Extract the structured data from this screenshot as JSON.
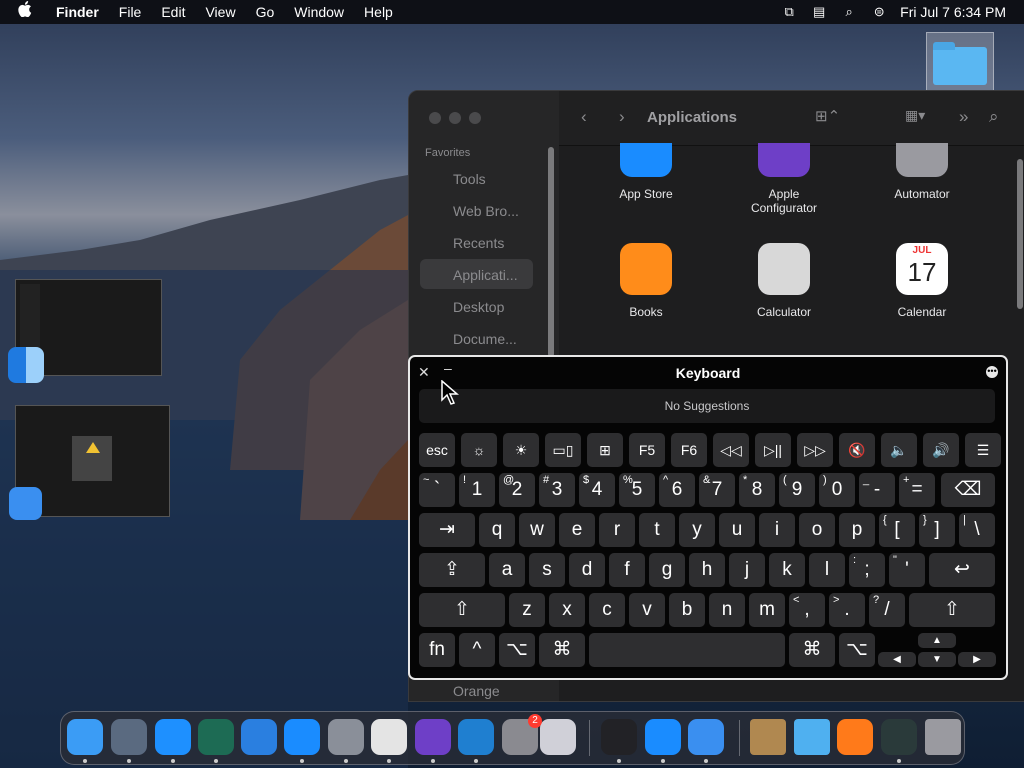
{
  "menubar": {
    "apple_icon": "apple-logo",
    "app_name": "Finder",
    "menus": [
      "File",
      "Edit",
      "View",
      "Go",
      "Window",
      "Help"
    ],
    "clock": "Fri Jul 7  6:34 PM"
  },
  "finder": {
    "sidebar_heading": "Favorites",
    "sidebar_items": [
      "Tools",
      "Web Bro...",
      "Recents",
      "Applicati...",
      "Desktop",
      "Docume...",
      "Orange"
    ],
    "title": "Applications",
    "apps": [
      {
        "label": "App Store",
        "color": "#1a8cff"
      },
      {
        "label": "Apple\nConfigurator",
        "color": "#6e3fc7"
      },
      {
        "label": "Automator",
        "color": "#9a9aa0"
      },
      {
        "label": "Books",
        "color": "#ff8c1a"
      },
      {
        "label": "Calculator",
        "color": "#d8d8d8"
      },
      {
        "label": "Calendar",
        "color": "#ffffff"
      }
    ],
    "calendar_month": "JUL",
    "calendar_day": "17"
  },
  "keyboard": {
    "title": "Keyboard",
    "suggestions": "No Suggestions",
    "fn_row": [
      "esc",
      "☼",
      "☀",
      "▭▯",
      "⊞",
      "F5",
      "F6",
      "◁◁",
      "▷||",
      "▷▷",
      "🔇",
      "🔈",
      "🔊",
      "☰"
    ],
    "number_row": [
      {
        "s": "~",
        "m": "`"
      },
      {
        "s": "!",
        "m": "1"
      },
      {
        "s": "@",
        "m": "2"
      },
      {
        "s": "#",
        "m": "3"
      },
      {
        "s": "$",
        "m": "4"
      },
      {
        "s": "%",
        "m": "5"
      },
      {
        "s": "^",
        "m": "6"
      },
      {
        "s": "&",
        "m": "7"
      },
      {
        "s": "*",
        "m": "8"
      },
      {
        "s": "(",
        "m": "9"
      },
      {
        "s": ")",
        "m": "0"
      },
      {
        "s": "_",
        "m": "-"
      },
      {
        "s": "+",
        "m": "="
      }
    ],
    "backspace": "⌫",
    "tab": "⇥",
    "row_q": [
      "q",
      "w",
      "e",
      "r",
      "t",
      "y",
      "u",
      "i",
      "o",
      "p"
    ],
    "row_q_sym": [
      {
        "s": "{",
        "m": "["
      },
      {
        "s": "}",
        "m": "]"
      },
      {
        "s": "|",
        "m": "\\"
      }
    ],
    "capslock": "⇪",
    "row_a": [
      "a",
      "s",
      "d",
      "f",
      "g",
      "h",
      "j",
      "k",
      "l"
    ],
    "row_a_sym": [
      {
        "s": ":",
        "m": ";"
      },
      {
        "s": "\"",
        "m": "'"
      }
    ],
    "return": "↩",
    "shift": "⇧",
    "row_z": [
      "z",
      "x",
      "c",
      "v",
      "b",
      "n",
      "m"
    ],
    "row_z_sym": [
      {
        "s": "<",
        "m": ","
      },
      {
        "s": ">",
        "m": "."
      },
      {
        "s": "?",
        "m": "/"
      }
    ],
    "bottom": {
      "fn": "fn",
      "ctrl": "^",
      "opt": "⌥",
      "cmd": "⌘"
    },
    "arrows": {
      "up": "▲",
      "left": "◀",
      "down": "▼",
      "right": "▶"
    }
  },
  "dock": {
    "apps": [
      {
        "name": "finder",
        "color": "#3b9cf5"
      },
      {
        "name": "mission-control",
        "color": "#5a6a80"
      },
      {
        "name": "safari",
        "color": "#1e90ff"
      },
      {
        "name": "time-machine",
        "color": "#1d6b54"
      },
      {
        "name": "xcode-instruments",
        "color": "#2a7fe0"
      },
      {
        "name": "app-store",
        "color": "#1a8cff"
      },
      {
        "name": "automator",
        "color": "#8a8f99"
      },
      {
        "name": "chrome",
        "color": "#e4e4e4"
      },
      {
        "name": "visual-studio",
        "color": "#6e3fc7"
      },
      {
        "name": "vscode",
        "color": "#1f7fd0"
      },
      {
        "name": "system-settings",
        "color": "#8a8a90"
      },
      {
        "name": "launchpad",
        "color": "#d0d0d8"
      },
      {
        "name": "terminal",
        "color": "#222226"
      },
      {
        "name": "app-store-2",
        "color": "#1a8cff"
      },
      {
        "name": "xcode",
        "color": "#3a8ff0"
      },
      {
        "name": "file-cabinet",
        "color": "#b08850"
      },
      {
        "name": "folder",
        "color": "#4fb0f0"
      },
      {
        "name": "firefox",
        "color": "#ff7a1a"
      },
      {
        "name": "activity-monitor",
        "color": "#2a3a3a"
      },
      {
        "name": "trash",
        "color": "#9a9aa0"
      }
    ],
    "settings_badge": "2"
  }
}
